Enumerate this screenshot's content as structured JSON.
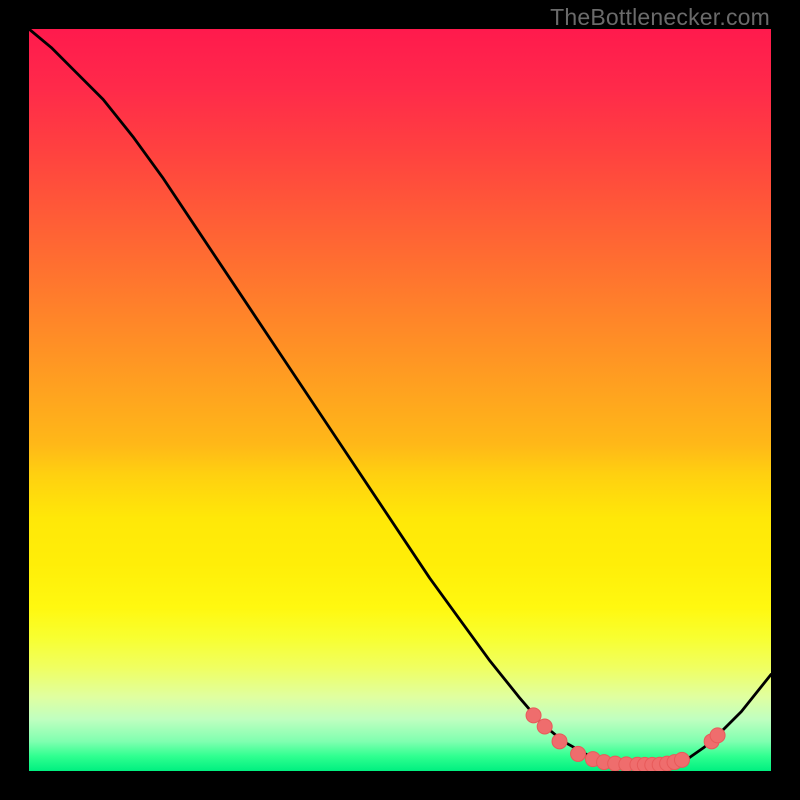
{
  "watermark": "TheBottlenecker.com",
  "colors": {
    "curve": "#000000",
    "dot_fill": "#ef6d6d",
    "dot_stroke": "#e85a5a"
  },
  "chart_data": {
    "type": "line",
    "title": "",
    "xlabel": "",
    "ylabel": "",
    "xlim": [
      0,
      100
    ],
    "ylim": [
      0,
      100
    ],
    "grid": false,
    "series": [
      {
        "name": "curve",
        "x": [
          0,
          3,
          6,
          10,
          14,
          18,
          22,
          26,
          30,
          34,
          38,
          42,
          46,
          50,
          54,
          58,
          62,
          66,
          69,
          72,
          75,
          78,
          81,
          84,
          87,
          89,
          91,
          93,
          96,
          100
        ],
        "y": [
          100,
          97.5,
          94.5,
          90.5,
          85.5,
          80,
          74,
          68,
          62,
          56,
          50,
          44,
          38,
          32,
          26,
          20.5,
          15,
          10,
          6.5,
          4,
          2.3,
          1.3,
          0.8,
          0.7,
          1.0,
          1.8,
          3.2,
          5,
          8,
          13
        ]
      }
    ],
    "dots": [
      {
        "x": 68,
        "y": 7.5
      },
      {
        "x": 69.5,
        "y": 6.0
      },
      {
        "x": 71.5,
        "y": 4.0
      },
      {
        "x": 74,
        "y": 2.3
      },
      {
        "x": 76,
        "y": 1.6
      },
      {
        "x": 77.5,
        "y": 1.2
      },
      {
        "x": 79,
        "y": 1.0
      },
      {
        "x": 80.5,
        "y": 0.9
      },
      {
        "x": 82,
        "y": 0.85
      },
      {
        "x": 83,
        "y": 0.82
      },
      {
        "x": 84,
        "y": 0.82
      },
      {
        "x": 85,
        "y": 0.85
      },
      {
        "x": 86,
        "y": 1.0
      },
      {
        "x": 87,
        "y": 1.2
      },
      {
        "x": 88,
        "y": 1.5
      },
      {
        "x": 92,
        "y": 4.0
      },
      {
        "x": 92.8,
        "y": 4.8
      }
    ]
  }
}
